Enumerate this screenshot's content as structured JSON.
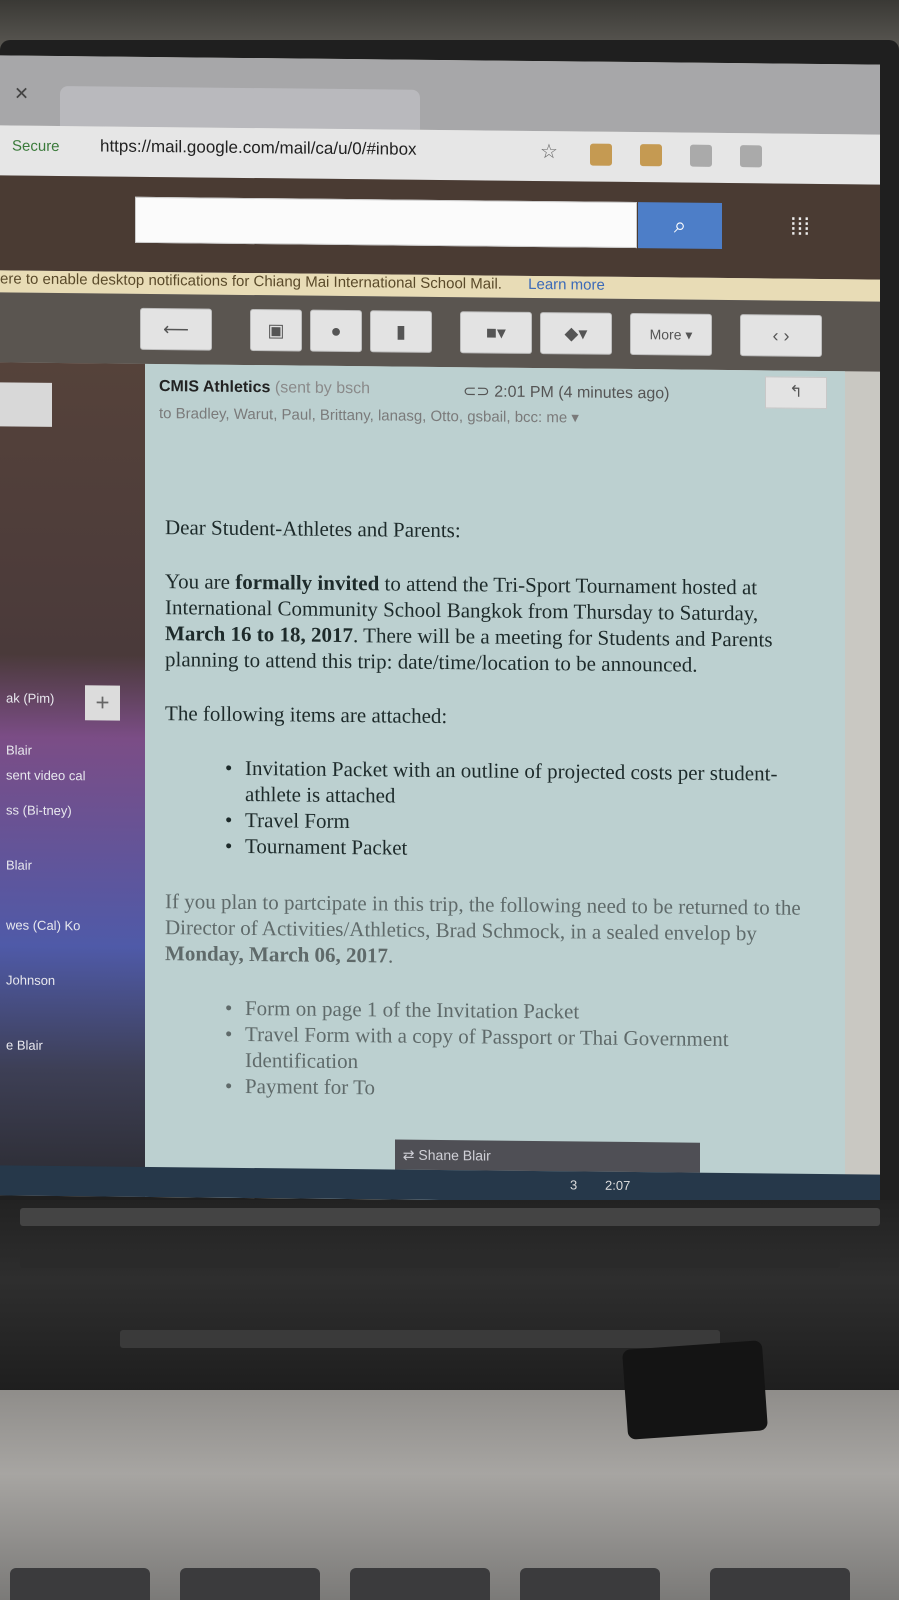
{
  "browser": {
    "secure_label": "Secure",
    "url": "https://mail.google.com/mail/ca/u/0/#inbox"
  },
  "gmail": {
    "notification": "ere to enable desktop notifications for Chiang Mai International School Mail.",
    "learn_more": "Learn more",
    "more_label": "More",
    "sidebar": {
      "items": [
        "ak (Pim)",
        "Blair",
        "sent video cal",
        "ss (Bi-tney)",
        "Blair",
        "wes (Cal) Ko",
        "Johnson",
        "e Blair"
      ]
    }
  },
  "email": {
    "sender": "CMIS Athletics",
    "sent_by": "(sent by bsch",
    "time": "2:01 PM (4 minutes ago)",
    "to": "to Bradley, Warut, Paul, Brittany, lanasg, Otto, gsbail, bcc: me",
    "greeting": "Dear Student-Athletes and Parents:",
    "p1_a": "You are ",
    "p1_bold": "formally invited",
    "p1_b": " to attend the Tri-Sport Tournament hosted at International Community School Bangkok from Thursday to Saturday, ",
    "p1_bold2": "March 16 to 18, 2017",
    "p1_c": ".  There will be a meeting for Students and Parents planning to attend this trip: date/time/location to be announced.",
    "attached_intro": "The following items are attached:",
    "attached": [
      "Invitation Packet with an outline of projected costs per student-athlete is attached",
      "Travel Form",
      "Tournament Packet"
    ],
    "p3_a": "If you plan to partcipate in this trip, the following need to be returned to the Director of Activities/Athletics, Brad Schmock, in a sealed envelop by ",
    "p3_bold": "Monday, March 06, 2017",
    "p3_end": ".",
    "needs": [
      "Form on page 1 of the Invitation Packet",
      "Travel Form with a copy of Passport or Thai Government Identification",
      "Payment for To"
    ]
  },
  "chat": {
    "label": "Shane Blair"
  },
  "taskbar": {
    "badge": "3",
    "clock": "2:07"
  }
}
